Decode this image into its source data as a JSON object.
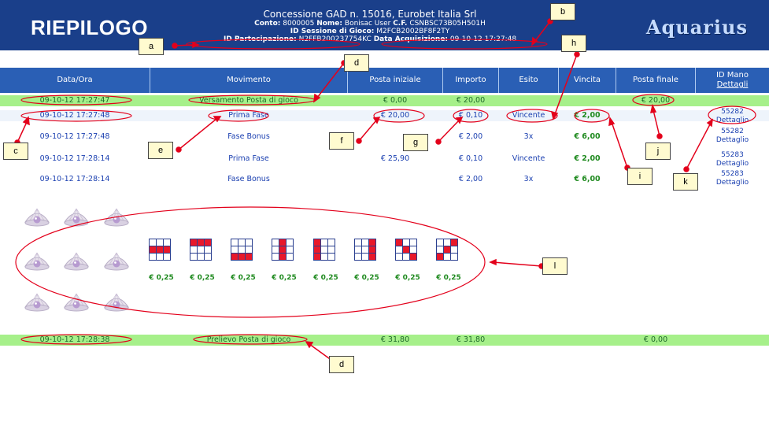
{
  "header": {
    "title": "RIEPILOGO",
    "brand": "Aquarius",
    "concession": "Concessione GAD n. 15016, Eurobet Italia Srl",
    "conto_label": "Conto:",
    "conto_value": "8000005",
    "nome_label": "Nome:",
    "nome_value": "Bonisac User",
    "cf_label": "C.F.",
    "cf_value": "CSNBSC73B05H501H",
    "sessione_label": "ID Sessione di Gioco:",
    "sessione_value": "M2FCB2002BF8F2TY",
    "partecipazione_label": "ID Partecipazione:",
    "partecipazione_value": "N2FFB200237754KC",
    "acquisizione_label": "Data Acquisizione:",
    "acquisizione_value": "09-10-12 17:27:48"
  },
  "table": {
    "columns": [
      "Data/Ora",
      "Movimento",
      "Posta iniziale",
      "Importo",
      "Esito",
      "Vincita",
      "Posta finale",
      "ID Mano",
      "Dettagli"
    ],
    "rows": [
      {
        "data": "09-10-12 17:27:47",
        "movimento": "Versamento Posta di gioco",
        "posta_iniziale": "€ 0,00",
        "importo": "€ 20,00",
        "esito": "",
        "vincita": "",
        "posta_finale": "€ 20,00",
        "id_mano": "",
        "dettaglio": ""
      },
      {
        "data": "09-10-12 17:27:48",
        "movimento": "Prima Fase",
        "posta_iniziale": "€ 20,00",
        "importo": "€ 0,10",
        "esito": "Vincente",
        "vincita": "€ 2,00",
        "posta_finale": "",
        "id_mano": "55282",
        "dettaglio": "Dettaglio"
      },
      {
        "data": "09-10-12 17:27:48",
        "movimento": "Fase Bonus",
        "posta_iniziale": "",
        "importo": "€ 2,00",
        "esito": "3x",
        "vincita": "€ 6,00",
        "posta_finale": "",
        "id_mano": "55282",
        "dettaglio": "Dettaglio"
      },
      {
        "data": "09-10-12 17:28:14",
        "movimento": "Prima Fase",
        "posta_iniziale": "€ 25,90",
        "importo": "€ 0,10",
        "esito": "Vincente",
        "vincita": "€ 2,00",
        "posta_finale": "",
        "id_mano": "55283",
        "dettaglio": "Dettaglio"
      },
      {
        "data": "09-10-12 17:28:14",
        "movimento": "Fase Bonus",
        "posta_iniziale": "",
        "importo": "€ 2,00",
        "esito": "3x",
        "vincita": "€ 6,00",
        "posta_finale": "",
        "id_mano": "55283",
        "dettaglio": "Dettaglio"
      },
      {
        "data": "09-10-12 17:28:38",
        "movimento": "Prelievo Posta di gioco",
        "posta_iniziale": "€ 31,80",
        "importo": "€ 31,80",
        "esito": "",
        "vincita": "",
        "posta_finale": "€ 0,00",
        "id_mano": "",
        "dettaglio": ""
      }
    ]
  },
  "game": {
    "pattern_amounts": [
      "€ 0,25",
      "€ 0,25",
      "€ 0,25",
      "€ 0,25",
      "€ 0,25",
      "€ 0,25",
      "€ 0,25",
      "€ 0,25"
    ]
  },
  "callouts": [
    "a",
    "b",
    "c",
    "d",
    "d",
    "e",
    "f",
    "g",
    "h",
    "i",
    "j",
    "k",
    "l"
  ],
  "colors": {
    "header_bg": "#1a3f8a",
    "table_header_bg": "#2a5fb5",
    "green_row": "#a6f08a",
    "win_green": "#1f8a1f",
    "annotation_red": "#e3001b",
    "callout_bg": "#fffbd0",
    "pattern_red": "#e8182a"
  },
  "icons": [
    "pearl-icon"
  ]
}
